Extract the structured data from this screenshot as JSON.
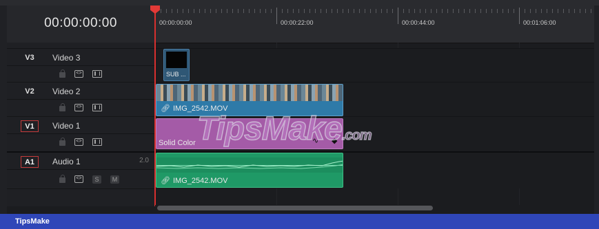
{
  "timeline": {
    "timecode": "00:00:00:00",
    "ruler_labels": [
      "00:00:00:00",
      "00:00:22:00",
      "00:00:44:00",
      "00:01:06:00"
    ]
  },
  "tracks": [
    {
      "id": "V3",
      "name": "Video 3",
      "selected": false
    },
    {
      "id": "V2",
      "name": "Video 2",
      "selected": false
    },
    {
      "id": "V1",
      "name": "Video 1",
      "selected": true
    },
    {
      "id": "A1",
      "name": "Audio 1",
      "selected": true,
      "volume": "2.0",
      "solo": "S",
      "mute": "M"
    }
  ],
  "clips": {
    "subtitle": "SUB ...",
    "video": "IMG_2542.MOV",
    "solid": "Solid Color",
    "audio": "IMG_2542.MOV"
  },
  "watermark": {
    "main": "TipsMake",
    "suffix": ".com"
  },
  "footer": {
    "brand": "TipsMake"
  },
  "colors": {
    "playhead": "#e33a37",
    "video_clip": "#2e7aa8",
    "solid_clip": "#a45ba7",
    "audio_clip": "#1f9966",
    "subtitle_clip": "#2f5775",
    "footer": "#2f46b8"
  }
}
